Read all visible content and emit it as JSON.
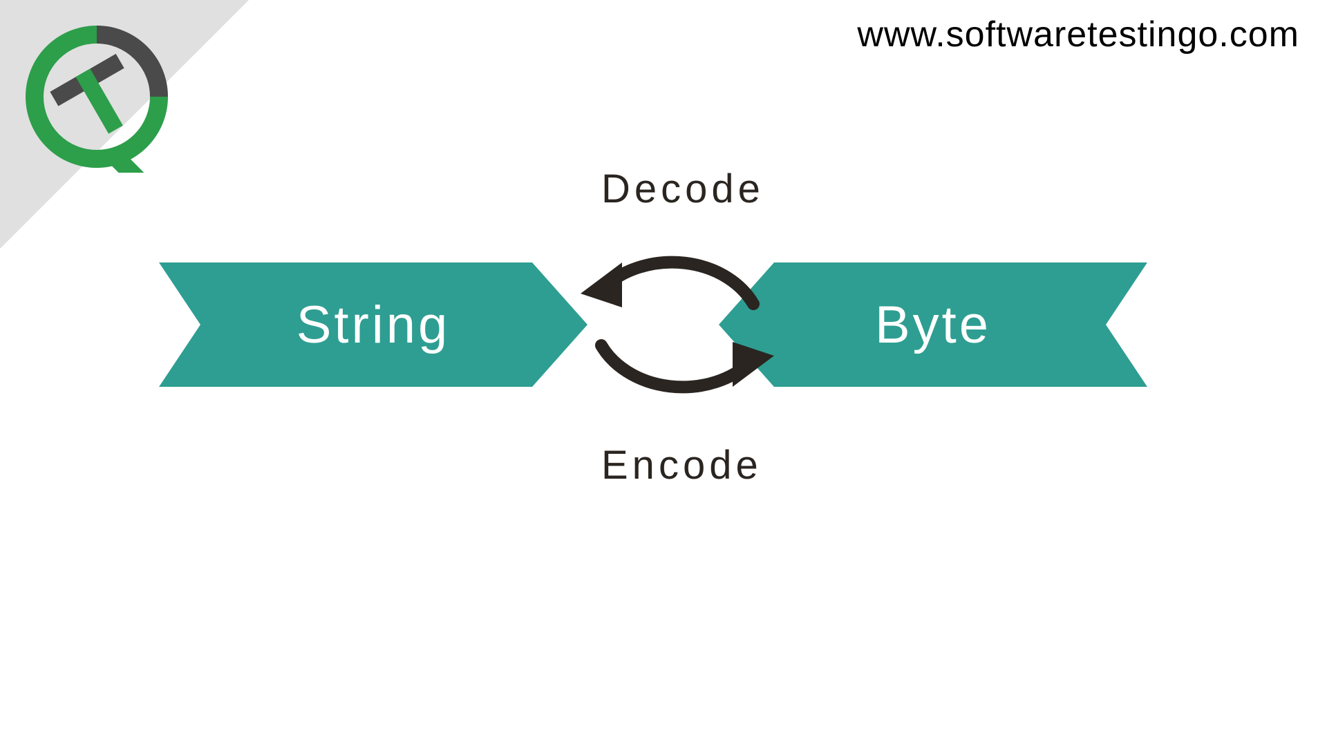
{
  "website_url": "www.softwaretestingo.com",
  "diagram": {
    "left_box": "String",
    "right_box": "Byte",
    "top_arrow_label": "Decode",
    "bottom_arrow_label": "Encode"
  },
  "colors": {
    "teal": "#2e9e92",
    "dark_arrow": "#2a2520",
    "logo_green": "#2d9e4a",
    "logo_gray": "#4a4a4a",
    "corner_gray": "#e0e0e0"
  }
}
